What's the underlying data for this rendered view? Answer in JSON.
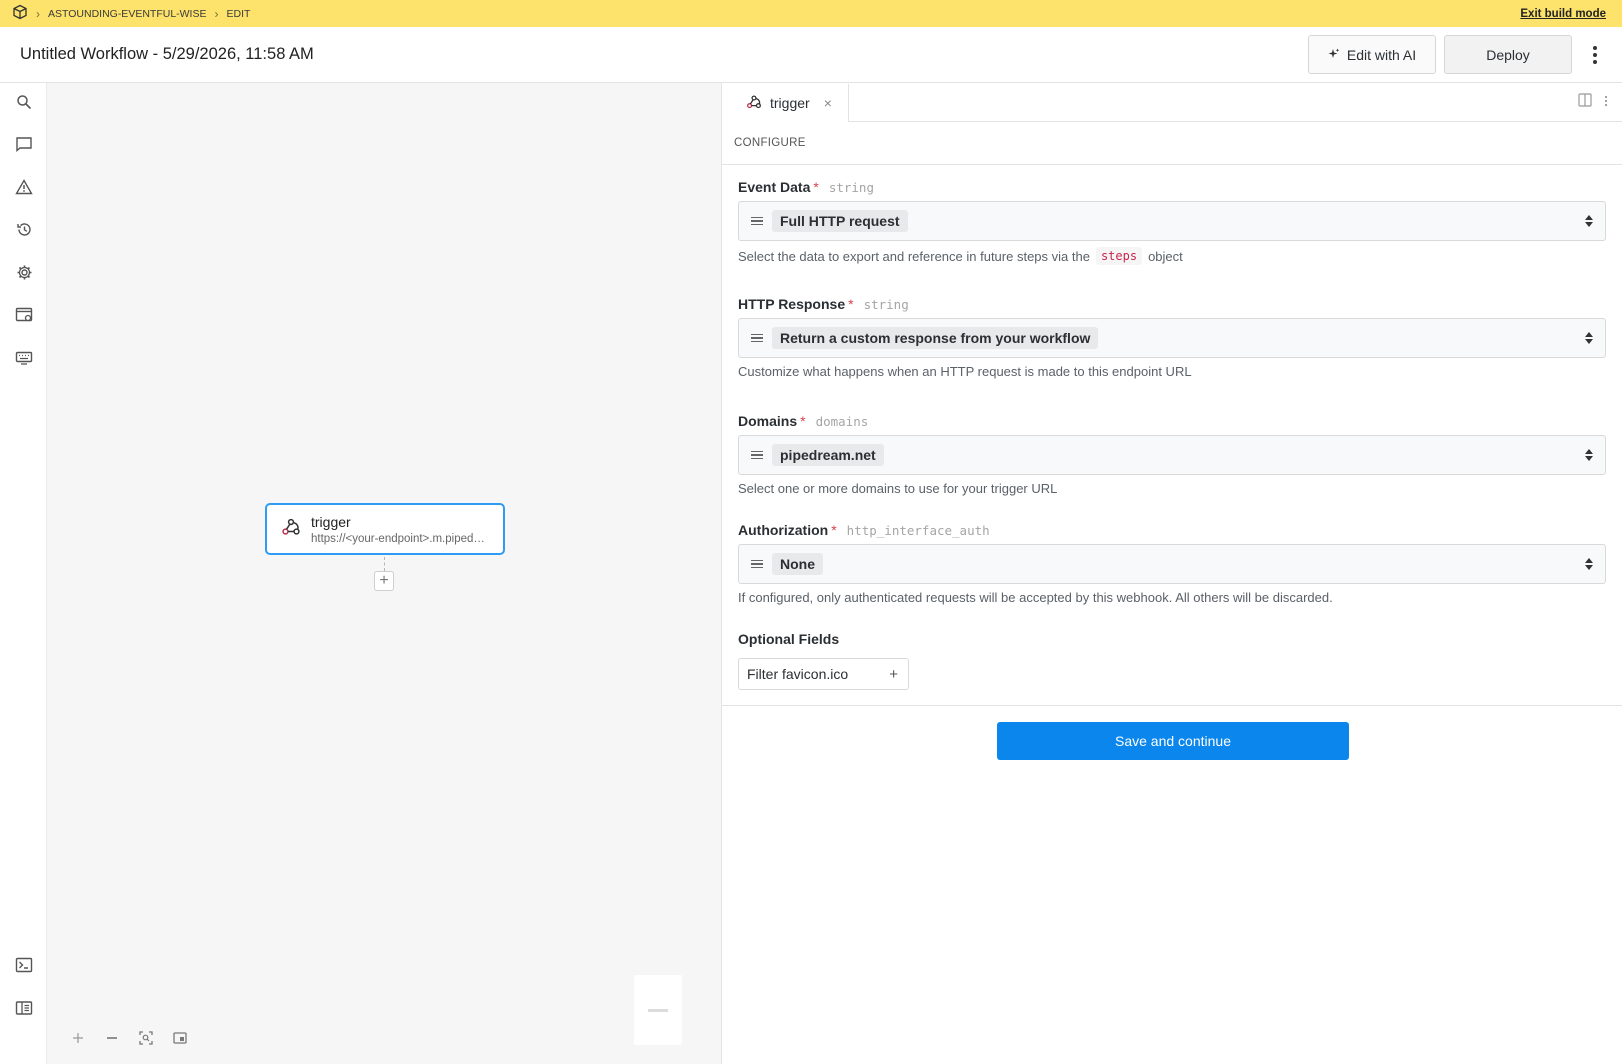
{
  "topbar": {
    "project": "ASTOUNDING-EVENTFUL-WISE",
    "mode": "EDIT",
    "exit_label": "Exit build mode"
  },
  "header": {
    "title": "Untitled Workflow - 5/29/2026, 11:58 AM",
    "edit_ai_label": "Edit with AI",
    "deploy_label": "Deploy"
  },
  "sidebar": {
    "top_icons": [
      "search-icon",
      "comment-icon",
      "warning-icon",
      "history-icon",
      "gear-icon",
      "browser-settings-icon",
      "keyboard-icon"
    ],
    "bottom_icons": [
      "terminal-icon",
      "panel-layout-icon"
    ]
  },
  "canvas": {
    "node": {
      "title": "trigger",
      "subtitle": "https://<your-endpoint>.m.pipedream.net"
    },
    "add_step": "+"
  },
  "panel": {
    "tab_label": "trigger",
    "tab_close": "×",
    "section": "CONFIGURE",
    "fields": [
      {
        "label": "Event Data",
        "required": "*",
        "type": "string",
        "value": "Full HTTP request",
        "help_before": "Select the data to export and reference in future steps via the",
        "help_code": "steps",
        "help_after": "object"
      },
      {
        "label": "HTTP Response",
        "required": "*",
        "type": "string",
        "value": "Return a custom response from your workflow",
        "help": "Customize what happens when an HTTP request is made to this endpoint URL"
      },
      {
        "label": "Domains",
        "required": "*",
        "type": "domains",
        "value": "pipedream.net",
        "help": "Select one or more domains to use for your trigger URL"
      },
      {
        "label": "Authorization",
        "required": "*",
        "type": "http_interface_auth",
        "value": "None",
        "help": "If configured, only authenticated requests will be accepted by this webhook. All others will be discarded."
      }
    ],
    "optional": {
      "title": "Optional Fields",
      "button_label": "Filter favicon.ico",
      "button_plus": "+"
    },
    "save_label": "Save and continue"
  },
  "colors": {
    "topbar": "#fde36b",
    "primary": "#0a86ec",
    "node_border": "#2e9cf5",
    "required": "#d8424b"
  }
}
